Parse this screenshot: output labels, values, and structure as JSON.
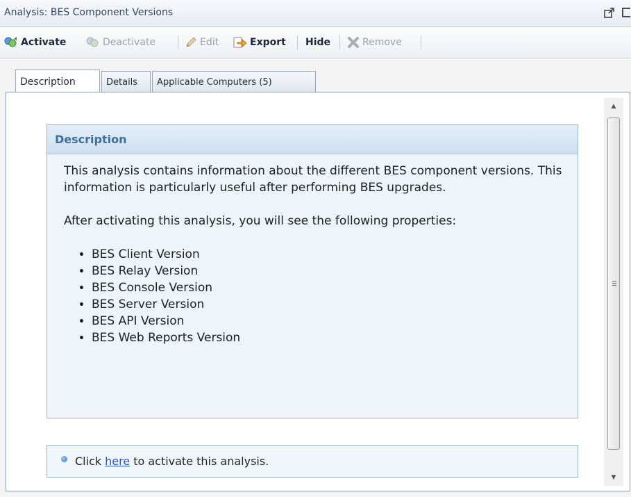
{
  "window": {
    "title": "Analysis: BES Component Versions"
  },
  "toolbar": {
    "activate": "Activate",
    "deactivate": "Deactivate",
    "edit": "Edit",
    "export": "Export",
    "hide": "Hide",
    "remove": "Remove"
  },
  "tabs": [
    {
      "label": "Description"
    },
    {
      "label": "Details"
    },
    {
      "label": "Applicable Computers (5)"
    }
  ],
  "description": {
    "header": "Description",
    "para1": "This analysis contains information about the different BES component versions. This information is particularly useful after performing BES upgrades.",
    "para2": "After activating this analysis, you will see the following properties:",
    "properties": [
      "BES Client Version",
      "BES Relay Version",
      "BES Console Version",
      "BES Server Version",
      "BES API Version",
      "BES Web Reports Version"
    ]
  },
  "action": {
    "prefix": "Click",
    "link": "here",
    "suffix": "to activate this analysis."
  },
  "icons": {
    "activate": "activate-icon",
    "deactivate": "deactivate-icon",
    "edit": "pencil-icon",
    "export": "export-icon",
    "remove": "remove-x-icon",
    "undock": "undock-icon",
    "maximize": "maximize-icon"
  }
}
